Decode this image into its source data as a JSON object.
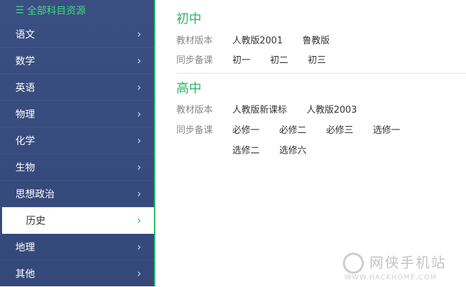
{
  "sidebar": {
    "header": "全部科目资源",
    "header_icon": "list-icon",
    "items": [
      {
        "label": "语文"
      },
      {
        "label": "数学"
      },
      {
        "label": "英语"
      },
      {
        "label": "物理"
      },
      {
        "label": "化学"
      },
      {
        "label": "生物"
      },
      {
        "label": "思想政治"
      },
      {
        "label": "历史"
      },
      {
        "label": "地理"
      },
      {
        "label": "其他"
      }
    ],
    "active": "历史",
    "chevron": "›"
  },
  "junior": {
    "title": "初中",
    "edition_label": "教材版本",
    "editions": [
      "人教版2001",
      "鲁教版"
    ],
    "sync_label": "同步备课",
    "syncs": [
      "初一",
      "初二",
      "初三"
    ]
  },
  "senior": {
    "title": "高中",
    "edition_label": "教材版本",
    "editions": [
      "人教版新课标",
      "人教版2003"
    ],
    "sync_label": "同步备课",
    "syncs": [
      "必修一",
      "必修二",
      "必修三",
      "选修一",
      "选修二",
      "选修六"
    ]
  },
  "watermark": {
    "text": "网侠手机站",
    "url": "WWW.HACKHOME.COM"
  },
  "colors": {
    "accent": "#2fb56a",
    "sidebar": "#3b4e82"
  }
}
